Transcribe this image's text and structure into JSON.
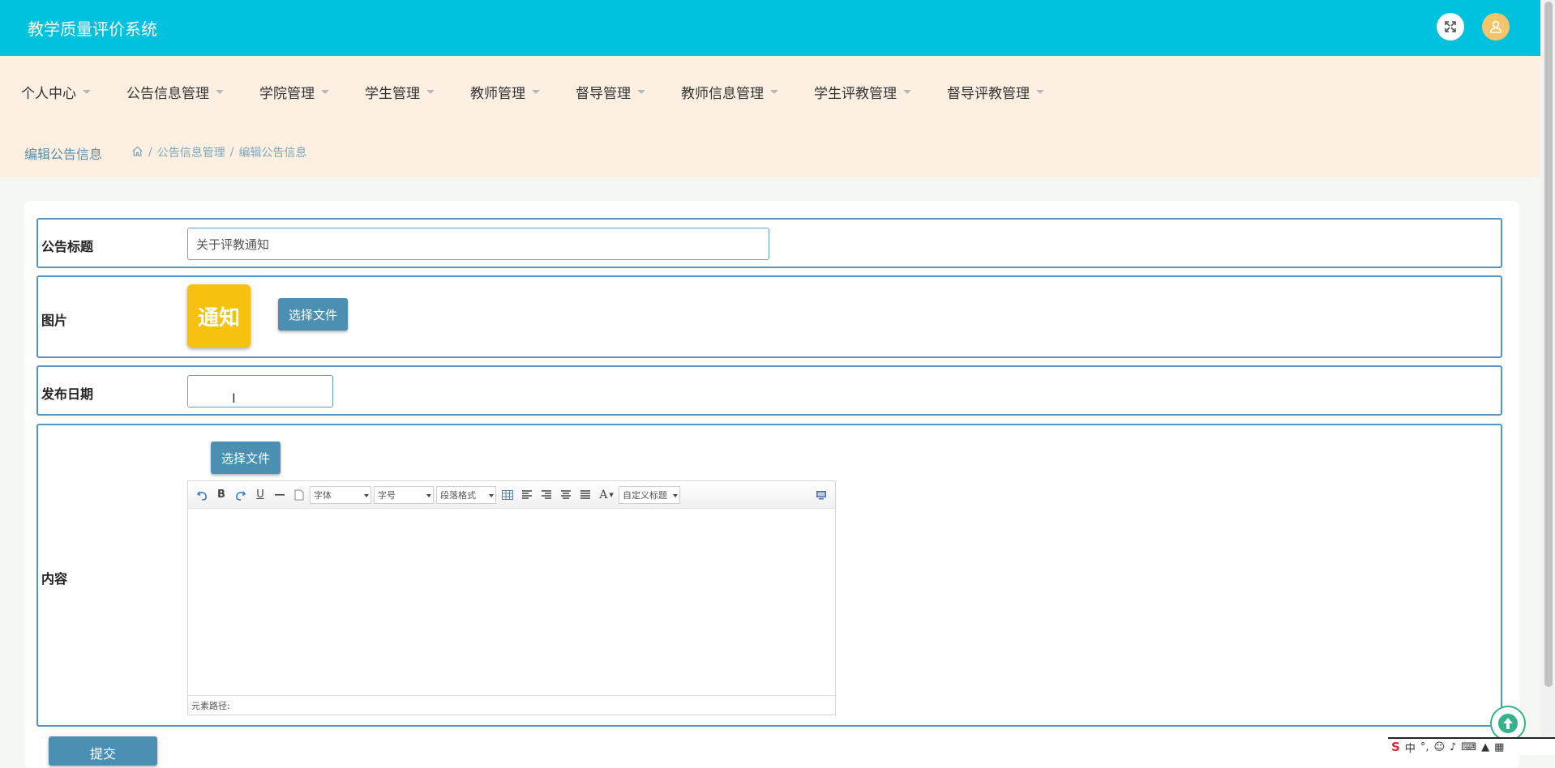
{
  "app": {
    "title": "教学质量评价系统"
  },
  "header_icons": {
    "fullscreen": "expand-icon",
    "avatar": "user-icon"
  },
  "nav": {
    "items": [
      {
        "label": "个人中心"
      },
      {
        "label": "公告信息管理"
      },
      {
        "label": "学院管理"
      },
      {
        "label": "学生管理"
      },
      {
        "label": "教师管理"
      },
      {
        "label": "督导管理"
      },
      {
        "label": "教师信息管理"
      },
      {
        "label": "学生评教管理"
      },
      {
        "label": "督导评教管理"
      }
    ]
  },
  "breadcrumb": {
    "page_title": "编辑公告信息",
    "home_icon": "home-icon",
    "sep": "/",
    "crumbs": [
      "公告信息管理",
      "编辑公告信息"
    ]
  },
  "form": {
    "title": {
      "label": "公告标题",
      "value": "关于评教通知"
    },
    "image": {
      "label": "图片",
      "thumb_text": "通知",
      "button": "选择文件"
    },
    "date": {
      "label": "发布日期",
      "value": ""
    },
    "content": {
      "label": "内容",
      "button": "选择文件",
      "toolbar": {
        "bold": "B",
        "underline": "U",
        "font": "字体",
        "size": "字号",
        "paragraph": "段落格式",
        "color": "A",
        "custom_title": "自定义标题"
      },
      "status": "元素路径:"
    },
    "submit": "提交"
  },
  "ime": {
    "label": "中"
  },
  "colors": {
    "header": "#00c2de",
    "nav_bg": "#fdf0e3",
    "border": "#5b92bd",
    "button": "#4b8fb3",
    "thumb": "#f6c20f"
  }
}
